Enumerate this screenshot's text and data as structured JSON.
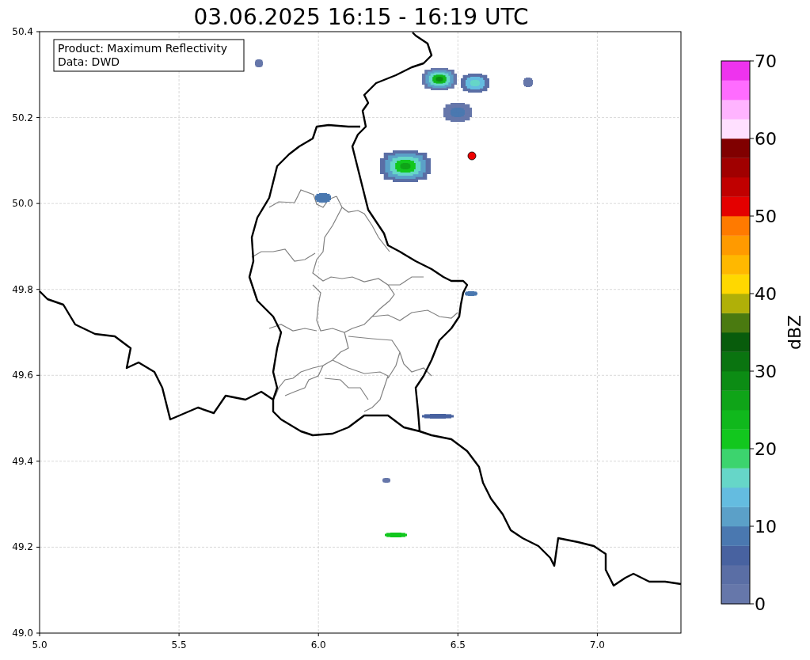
{
  "title": "03.06.2025 16:15 - 16:19 UTC",
  "info_box": [
    "Product: Maximum Reflectivity",
    "Data: DWD"
  ],
  "x_ticks": [
    "5.0",
    "5.5",
    "6.0",
    "6.5",
    "7.0"
  ],
  "y_ticks": [
    "50.4",
    "50.2",
    "50.0",
    "49.8",
    "49.6",
    "49.4",
    "49.2",
    "49.0"
  ],
  "colorbar": {
    "label": "dBZ",
    "ticks": [
      "70",
      "60",
      "50",
      "40",
      "30",
      "20",
      "10",
      "0"
    ],
    "segments": [
      {
        "color": "#6677aa"
      },
      {
        "color": "#5a6ea5"
      },
      {
        "color": "#4862a0"
      },
      {
        "color": "#4a78b0"
      },
      {
        "color": "#5ba0c8"
      },
      {
        "color": "#64bce0"
      },
      {
        "color": "#66d6c8"
      },
      {
        "color": "#3cd46e"
      },
      {
        "color": "#12c71e"
      },
      {
        "color": "#10b81c"
      },
      {
        "color": "#0fa418"
      },
      {
        "color": "#0c8c14"
      },
      {
        "color": "#0a7410"
      },
      {
        "color": "#085c0c"
      },
      {
        "color": "#4a7a10"
      },
      {
        "color": "#b0b008"
      },
      {
        "color": "#ffd800"
      },
      {
        "color": "#ffb800"
      },
      {
        "color": "#ff9a00"
      },
      {
        "color": "#ff7a00"
      },
      {
        "color": "#e40000"
      },
      {
        "color": "#c00000"
      },
      {
        "color": "#a00000"
      },
      {
        "color": "#800000"
      },
      {
        "color": "#ffe0ff"
      },
      {
        "color": "#ffb4ff"
      },
      {
        "color": "#ff6cff"
      },
      {
        "color": "#ee33ee"
      }
    ]
  }
}
